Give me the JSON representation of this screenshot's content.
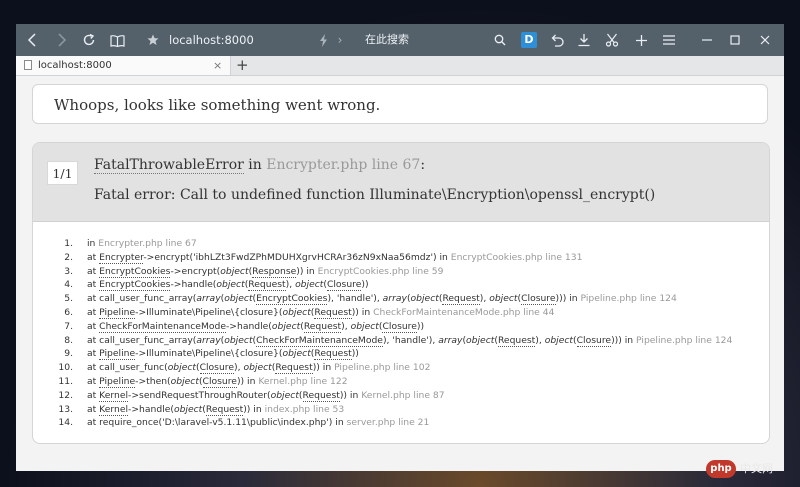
{
  "toolbar": {
    "url": "localhost:8000",
    "search_placeholder": "在此搜索",
    "d_badge": "D"
  },
  "tab": {
    "title": "localhost:8000",
    "close": "×",
    "new_tab": "+"
  },
  "page": {
    "whoops": "Whoops, looks like something went wrong.",
    "counter": "1/1",
    "exception_class": "FatalThrowableError",
    "exception_in": " in ",
    "exception_file": "Encrypter.php line 67",
    "exception_colon": ":",
    "message": "Fatal error: Call to undefined function Illuminate\\Encryption\\openssl_encrypt()"
  },
  "trace": [
    {
      "n": "1.",
      "parts": [
        {
          "t": "in "
        }
      ],
      "loc": "Encrypter.php line 67"
    },
    {
      "n": "2.",
      "parts": [
        {
          "t": "at "
        },
        {
          "t": "Encrypter",
          "u": true
        },
        {
          "t": "->encrypt('ibhLZt3FwdZPhMDUHXgrvHCRAr36zN9xNaa56mdz')"
        },
        {
          "t": " in "
        }
      ],
      "loc": "EncryptCookies.php line 131"
    },
    {
      "n": "3.",
      "parts": [
        {
          "t": "at "
        },
        {
          "t": "EncryptCookies",
          "u": true
        },
        {
          "t": "->encrypt("
        },
        {
          "t": "object",
          "i": true
        },
        {
          "t": "("
        },
        {
          "t": "Response",
          "u": true
        },
        {
          "t": ")) in "
        }
      ],
      "loc": "EncryptCookies.php line 59"
    },
    {
      "n": "4.",
      "parts": [
        {
          "t": "at "
        },
        {
          "t": "EncryptCookies",
          "u": true
        },
        {
          "t": "->handle("
        },
        {
          "t": "object",
          "i": true
        },
        {
          "t": "("
        },
        {
          "t": "Request",
          "u": true
        },
        {
          "t": "), "
        },
        {
          "t": "object",
          "i": true
        },
        {
          "t": "("
        },
        {
          "t": "Closure",
          "u": true
        },
        {
          "t": "))"
        }
      ],
      "loc": ""
    },
    {
      "n": "5.",
      "parts": [
        {
          "t": "at call_user_func_array("
        },
        {
          "t": "array",
          "i": true
        },
        {
          "t": "("
        },
        {
          "t": "object",
          "i": true
        },
        {
          "t": "("
        },
        {
          "t": "EncryptCookies",
          "u": true
        },
        {
          "t": "), 'handle'), "
        },
        {
          "t": "array",
          "i": true
        },
        {
          "t": "("
        },
        {
          "t": "object",
          "i": true
        },
        {
          "t": "("
        },
        {
          "t": "Request",
          "u": true
        },
        {
          "t": "), "
        },
        {
          "t": "object",
          "i": true
        },
        {
          "t": "("
        },
        {
          "t": "Closure",
          "u": true
        },
        {
          "t": "))) in "
        }
      ],
      "loc": "Pipeline.php line 124"
    },
    {
      "n": "6.",
      "parts": [
        {
          "t": "at "
        },
        {
          "t": "Pipeline",
          "u": true
        },
        {
          "t": "->Illuminate\\Pipeline\\{closure}("
        },
        {
          "t": "object",
          "i": true
        },
        {
          "t": "("
        },
        {
          "t": "Request",
          "u": true
        },
        {
          "t": ")) in "
        }
      ],
      "loc": "CheckForMaintenanceMode.php line 44"
    },
    {
      "n": "7.",
      "parts": [
        {
          "t": "at "
        },
        {
          "t": "CheckForMaintenanceMode",
          "u": true
        },
        {
          "t": "->handle("
        },
        {
          "t": "object",
          "i": true
        },
        {
          "t": "("
        },
        {
          "t": "Request",
          "u": true
        },
        {
          "t": "), "
        },
        {
          "t": "object",
          "i": true
        },
        {
          "t": "("
        },
        {
          "t": "Closure",
          "u": true
        },
        {
          "t": "))"
        }
      ],
      "loc": ""
    },
    {
      "n": "8.",
      "parts": [
        {
          "t": "at call_user_func_array("
        },
        {
          "t": "array",
          "i": true
        },
        {
          "t": "("
        },
        {
          "t": "object",
          "i": true
        },
        {
          "t": "("
        },
        {
          "t": "CheckForMaintenanceMode",
          "u": true
        },
        {
          "t": "), 'handle'), "
        },
        {
          "t": "array",
          "i": true
        },
        {
          "t": "("
        },
        {
          "t": "object",
          "i": true
        },
        {
          "t": "("
        },
        {
          "t": "Request",
          "u": true
        },
        {
          "t": "), "
        },
        {
          "t": "object",
          "i": true
        },
        {
          "t": "("
        },
        {
          "t": "Closure",
          "u": true
        },
        {
          "t": "))) in "
        }
      ],
      "loc": "Pipeline.php line 124"
    },
    {
      "n": "9.",
      "parts": [
        {
          "t": "at "
        },
        {
          "t": "Pipeline",
          "u": true
        },
        {
          "t": "->Illuminate\\Pipeline\\{closure}("
        },
        {
          "t": "object",
          "i": true
        },
        {
          "t": "("
        },
        {
          "t": "Request",
          "u": true
        },
        {
          "t": "))"
        }
      ],
      "loc": ""
    },
    {
      "n": "10.",
      "parts": [
        {
          "t": "at call_user_func("
        },
        {
          "t": "object",
          "i": true
        },
        {
          "t": "("
        },
        {
          "t": "Closure",
          "u": true
        },
        {
          "t": "), "
        },
        {
          "t": "object",
          "i": true
        },
        {
          "t": "("
        },
        {
          "t": "Request",
          "u": true
        },
        {
          "t": ")) in "
        }
      ],
      "loc": "Pipeline.php line 102"
    },
    {
      "n": "11.",
      "parts": [
        {
          "t": "at "
        },
        {
          "t": "Pipeline",
          "u": true
        },
        {
          "t": "->then("
        },
        {
          "t": "object",
          "i": true
        },
        {
          "t": "("
        },
        {
          "t": "Closure",
          "u": true
        },
        {
          "t": ")) in "
        }
      ],
      "loc": "Kernel.php line 122"
    },
    {
      "n": "12.",
      "parts": [
        {
          "t": "at "
        },
        {
          "t": "Kernel",
          "u": true
        },
        {
          "t": "->sendRequestThroughRouter("
        },
        {
          "t": "object",
          "i": true
        },
        {
          "t": "("
        },
        {
          "t": "Request",
          "u": true
        },
        {
          "t": ")) in "
        }
      ],
      "loc": "Kernel.php line 87"
    },
    {
      "n": "13.",
      "parts": [
        {
          "t": "at "
        },
        {
          "t": "Kernel",
          "u": true
        },
        {
          "t": "->handle("
        },
        {
          "t": "object",
          "i": true
        },
        {
          "t": "("
        },
        {
          "t": "Request",
          "u": true
        },
        {
          "t": ")) in "
        }
      ],
      "loc": "index.php line 53"
    },
    {
      "n": "14.",
      "parts": [
        {
          "t": "at require_once('D:\\laravel-v5.1.11\\public\\index.php') in "
        }
      ],
      "loc": "server.php line 21"
    }
  ],
  "watermark": {
    "badge": "php",
    "text": "中文网"
  }
}
